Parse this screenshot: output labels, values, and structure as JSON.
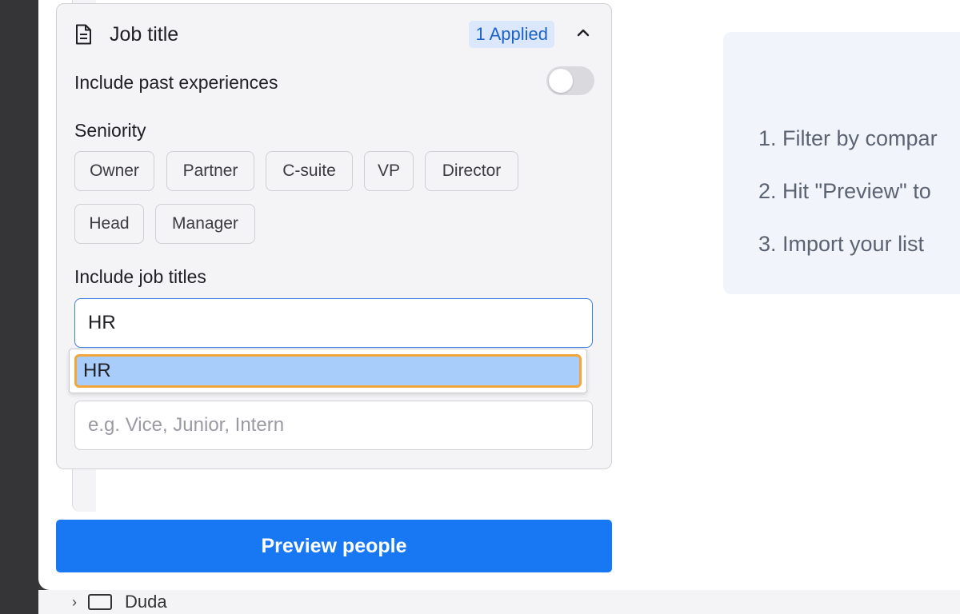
{
  "behind": {
    "folder_label": "Duda"
  },
  "panel": {
    "title": "Job title",
    "applied_badge": "1 Applied",
    "past_experiences_label": "Include past experiences",
    "past_experiences_on": false,
    "seniority_label": "Seniority",
    "seniority_options": [
      "Owner",
      "Partner",
      "C-suite",
      "VP",
      "Director",
      "Head",
      "Manager"
    ],
    "include_titles_label": "Include job titles",
    "include_titles_value": "HR",
    "suggestion": "HR",
    "exclude_placeholder": "e.g. Vice, Junior, Intern"
  },
  "preview_button": "Preview people",
  "hints": [
    "1. Filter by compar",
    "2. Hit \"Preview\" to",
    "3. Import your list"
  ],
  "colors": {
    "primary": "#1877f2",
    "badge_bg": "#dbe8fb",
    "badge_text": "#1d62c9",
    "highlight": "#a8cdfb",
    "focus_ring": "#f4a63a"
  }
}
